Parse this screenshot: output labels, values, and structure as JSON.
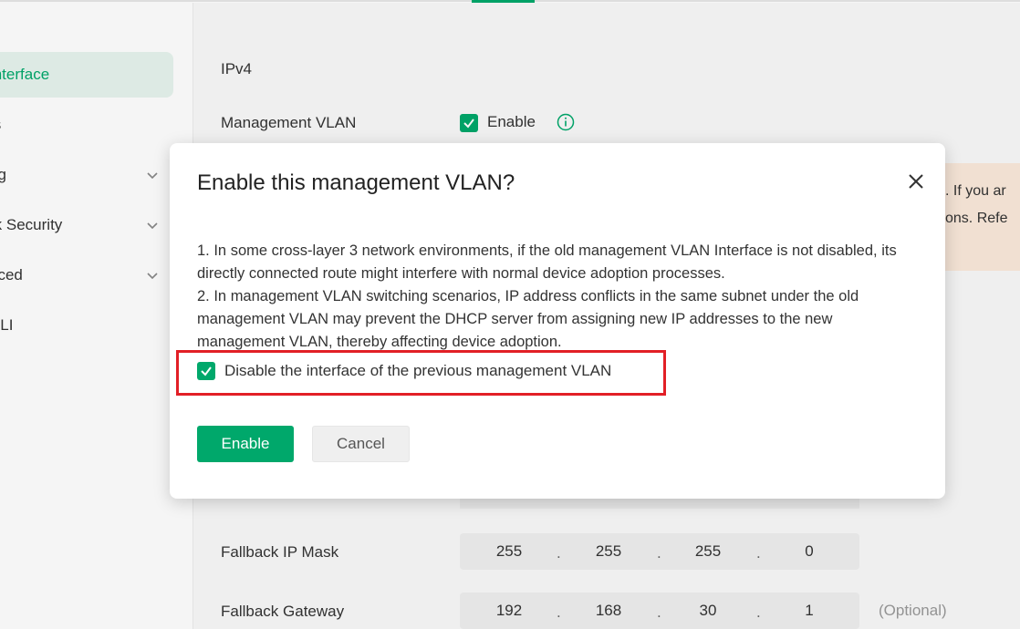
{
  "sidebar": {
    "items": [
      {
        "label": "Interface",
        "active": true,
        "chevron": false
      },
      {
        "label": "ts",
        "active": false,
        "chevron": false
      },
      {
        "label": "ng",
        "active": false,
        "chevron": true
      },
      {
        "label": "rk Security",
        "active": false,
        "chevron": true
      },
      {
        "label": "nced",
        "active": false,
        "chevron": true
      },
      {
        "label": "CLI",
        "active": false,
        "chevron": false
      }
    ]
  },
  "content": {
    "ipv4_label": "IPv4",
    "management_vlan_label": "Management VLAN",
    "management_vlan_enable_label": "Enable",
    "warning_line1": "s. If you ar",
    "warning_line2": "tions. Refe",
    "fallback_ip_mask_label": "Fallback IP Mask",
    "fallback_ip_mask": [
      "255",
      "255",
      "255",
      "0"
    ],
    "fallback_gateway_label": "Fallback Gateway",
    "fallback_gateway": [
      "192",
      "168",
      "30",
      "1"
    ],
    "optional_label": "(Optional)"
  },
  "dialog": {
    "title": "Enable this management VLAN?",
    "body_line1": "1. In some cross-layer 3 network environments, if the old management VLAN Interface is not disabled, its directly connected route might interfere with normal device adoption processes.",
    "body_line2": "2. In management VLAN switching scenarios, IP address conflicts in the same subnet under the old management VLAN may prevent the DHCP server from assigning new IP addresses to the new management VLAN, thereby affecting device adoption.",
    "checkbox_label": "Disable the interface of the previous management VLAN",
    "checkbox_checked": true,
    "enable_button": "Enable",
    "cancel_button": "Cancel"
  },
  "colors": {
    "accent": "#00a86b",
    "highlight_border": "#e21f26",
    "active_sidebar_bg": "#e7f4ee",
    "warning_bg": "#fbeadb"
  }
}
